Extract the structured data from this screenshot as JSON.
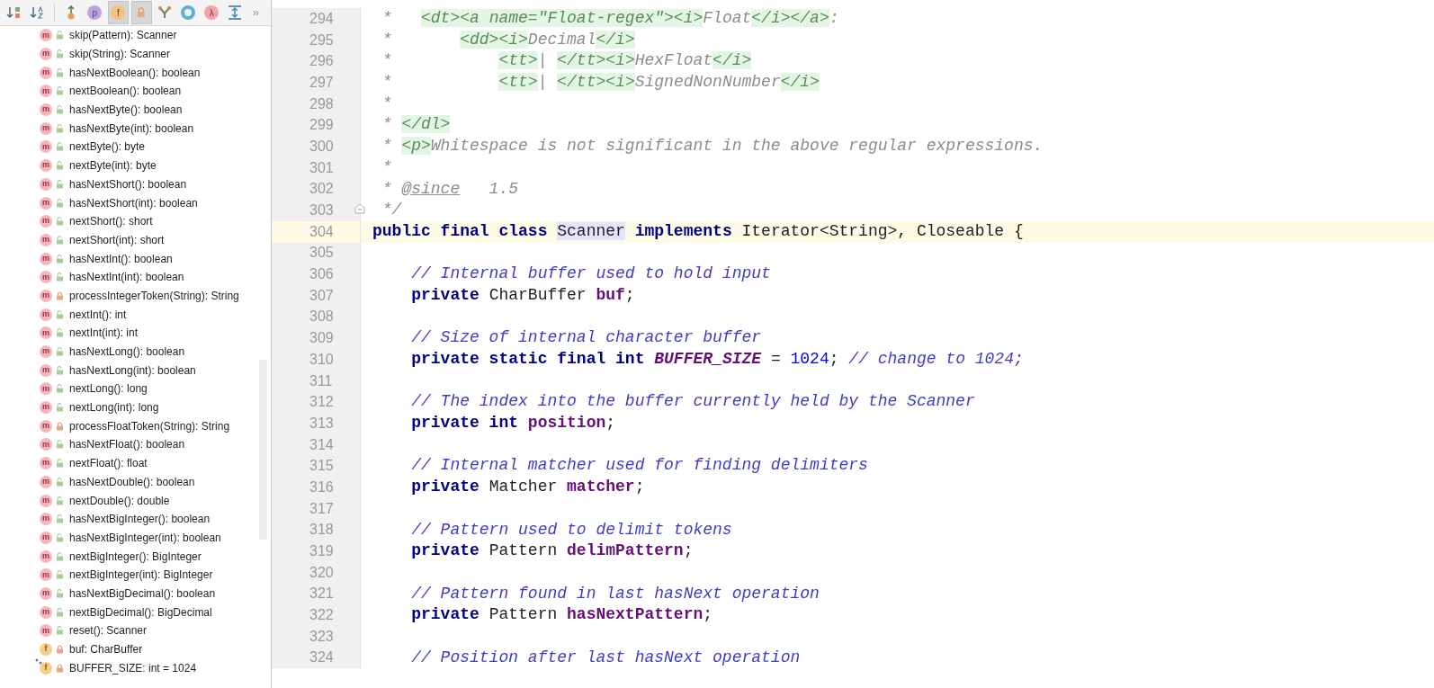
{
  "toolbar": [
    {
      "kind": "sort-visibility",
      "selected": false
    },
    {
      "kind": "sort-alpha",
      "selected": false
    },
    {
      "kind": "separator"
    },
    {
      "kind": "inherited",
      "selected": false
    },
    {
      "kind": "letter",
      "label": "p",
      "color": "#b9a6e0",
      "selected": false
    },
    {
      "kind": "letter",
      "label": "f",
      "color": "#f2c37a",
      "selected": true
    },
    {
      "kind": "lock",
      "selected": true
    },
    {
      "kind": "anonymous",
      "selected": false
    },
    {
      "kind": "ring",
      "selected": false
    },
    {
      "kind": "letter",
      "label": "λ",
      "color": "#f1a3a8",
      "selected": false
    },
    {
      "kind": "expand",
      "selected": false
    },
    {
      "kind": "more",
      "label": "»",
      "selected": false
    }
  ],
  "members": [
    {
      "kind": "method",
      "badge": "m",
      "private": false,
      "label": "skip(Pattern): Scanner"
    },
    {
      "kind": "method",
      "badge": "m",
      "private": false,
      "label": "skip(String): Scanner"
    },
    {
      "kind": "method",
      "badge": "m",
      "private": false,
      "label": "hasNextBoolean(): boolean"
    },
    {
      "kind": "method",
      "badge": "m",
      "private": false,
      "label": "nextBoolean(): boolean"
    },
    {
      "kind": "method",
      "badge": "m",
      "private": false,
      "label": "hasNextByte(): boolean"
    },
    {
      "kind": "method",
      "badge": "m",
      "private": false,
      "label": "hasNextByte(int): boolean"
    },
    {
      "kind": "method",
      "badge": "m",
      "private": false,
      "label": "nextByte(): byte"
    },
    {
      "kind": "method",
      "badge": "m",
      "private": false,
      "label": "nextByte(int): byte"
    },
    {
      "kind": "method",
      "badge": "m",
      "private": false,
      "label": "hasNextShort(): boolean"
    },
    {
      "kind": "method",
      "badge": "m",
      "private": false,
      "label": "hasNextShort(int): boolean"
    },
    {
      "kind": "method",
      "badge": "m",
      "private": false,
      "label": "nextShort(): short"
    },
    {
      "kind": "method",
      "badge": "m",
      "private": false,
      "label": "nextShort(int): short"
    },
    {
      "kind": "method",
      "badge": "m",
      "private": false,
      "label": "hasNextInt(): boolean"
    },
    {
      "kind": "method",
      "badge": "m",
      "private": false,
      "label": "hasNextInt(int): boolean"
    },
    {
      "kind": "method",
      "badge": "m",
      "private": true,
      "label": "processIntegerToken(String): String"
    },
    {
      "kind": "method",
      "badge": "m",
      "private": false,
      "label": "nextInt(): int"
    },
    {
      "kind": "method",
      "badge": "m",
      "private": false,
      "label": "nextInt(int): int"
    },
    {
      "kind": "method",
      "badge": "m",
      "private": false,
      "label": "hasNextLong(): boolean"
    },
    {
      "kind": "method",
      "badge": "m",
      "private": false,
      "label": "hasNextLong(int): boolean"
    },
    {
      "kind": "method",
      "badge": "m",
      "private": false,
      "label": "nextLong(): long"
    },
    {
      "kind": "method",
      "badge": "m",
      "private": false,
      "label": "nextLong(int): long"
    },
    {
      "kind": "method",
      "badge": "m",
      "private": true,
      "label": "processFloatToken(String): String"
    },
    {
      "kind": "method",
      "badge": "m",
      "private": false,
      "label": "hasNextFloat(): boolean"
    },
    {
      "kind": "method",
      "badge": "m",
      "private": false,
      "label": "nextFloat(): float"
    },
    {
      "kind": "method",
      "badge": "m",
      "private": false,
      "label": "hasNextDouble(): boolean"
    },
    {
      "kind": "method",
      "badge": "m",
      "private": false,
      "label": "nextDouble(): double"
    },
    {
      "kind": "method",
      "badge": "m",
      "private": false,
      "label": "hasNextBigInteger(): boolean"
    },
    {
      "kind": "method",
      "badge": "m",
      "private": false,
      "label": "hasNextBigInteger(int): boolean"
    },
    {
      "kind": "method",
      "badge": "m",
      "private": false,
      "label": "nextBigInteger(): BigInteger"
    },
    {
      "kind": "method",
      "badge": "m",
      "private": false,
      "label": "nextBigInteger(int): BigInteger"
    },
    {
      "kind": "method",
      "badge": "m",
      "private": false,
      "label": "hasNextBigDecimal(): boolean"
    },
    {
      "kind": "method",
      "badge": "m",
      "private": false,
      "label": "nextBigDecimal(): BigDecimal"
    },
    {
      "kind": "method",
      "badge": "m",
      "private": false,
      "label": "reset(): Scanner"
    },
    {
      "kind": "field",
      "badge": "f",
      "private": true,
      "label": "buf: CharBuffer"
    },
    {
      "kind": "static-field",
      "badge": "f",
      "private": true,
      "label": "BUFFER_SIZE: int = 1024"
    }
  ],
  "code": [
    {
      "number": "294",
      "current": false,
      "tokens": [
        {
          "kind": "doc",
          "text": " *   "
        },
        {
          "kind": "tag",
          "text": "<dt><a name=\"Float-regex\"><i>"
        },
        {
          "kind": "doc",
          "text": "Float"
        },
        {
          "kind": "tag",
          "text": "</i></a>"
        },
        {
          "kind": "doc",
          "text": ":"
        }
      ]
    },
    {
      "number": "295",
      "current": false,
      "tokens": [
        {
          "kind": "doc",
          "text": " *       "
        },
        {
          "kind": "tag",
          "text": "<dd><i>"
        },
        {
          "kind": "doc",
          "text": "Decimal"
        },
        {
          "kind": "tag",
          "text": "</i>"
        }
      ]
    },
    {
      "number": "296",
      "current": false,
      "tokens": [
        {
          "kind": "doc",
          "text": " *           "
        },
        {
          "kind": "tag",
          "text": "<tt>"
        },
        {
          "kind": "doc",
          "text": "| "
        },
        {
          "kind": "tag",
          "text": "</tt><i>"
        },
        {
          "kind": "doc",
          "text": "HexFloat"
        },
        {
          "kind": "tag",
          "text": "</i>"
        }
      ]
    },
    {
      "number": "297",
      "current": false,
      "tokens": [
        {
          "kind": "doc",
          "text": " *           "
        },
        {
          "kind": "tag",
          "text": "<tt>"
        },
        {
          "kind": "doc",
          "text": "| "
        },
        {
          "kind": "tag",
          "text": "</tt><i>"
        },
        {
          "kind": "doc",
          "text": "SignedNonNumber"
        },
        {
          "kind": "tag",
          "text": "</i>"
        }
      ]
    },
    {
      "number": "298",
      "current": false,
      "tokens": [
        {
          "kind": "doc",
          "text": " *"
        }
      ]
    },
    {
      "number": "299",
      "current": false,
      "tokens": [
        {
          "kind": "doc",
          "text": " * "
        },
        {
          "kind": "tag",
          "text": "</dl>"
        }
      ]
    },
    {
      "number": "300",
      "current": false,
      "tokens": [
        {
          "kind": "doc",
          "text": " * "
        },
        {
          "kind": "tag",
          "text": "<p>"
        },
        {
          "kind": "doc",
          "text": "Whitespace is not significant in the above regular expressions."
        }
      ]
    },
    {
      "number": "301",
      "current": false,
      "tokens": [
        {
          "kind": "doc",
          "text": " *"
        }
      ]
    },
    {
      "number": "302",
      "current": false,
      "tokens": [
        {
          "kind": "doc",
          "text": " * "
        },
        {
          "kind": "doctag",
          "text": "@since"
        },
        {
          "kind": "doc",
          "text": "   1.5"
        }
      ]
    },
    {
      "number": "303",
      "current": false,
      "fold": true,
      "tokens": [
        {
          "kind": "doc",
          "text": " */"
        }
      ]
    },
    {
      "number": "304",
      "current": true,
      "tokens": [
        {
          "kind": "keyword",
          "text": "public final class "
        },
        {
          "kind": "usage",
          "text": "Scanner"
        },
        {
          "kind": "keyword",
          "text": " implements "
        },
        {
          "kind": "plain",
          "text": "Iterator<String>, Closeable {"
        }
      ]
    },
    {
      "number": "305",
      "current": false
    },
    {
      "number": "306",
      "current": false,
      "tokens": [
        {
          "kind": "comment",
          "text": "    // Internal buffer used to hold input"
        }
      ]
    },
    {
      "number": "307",
      "current": false,
      "tokens": [
        {
          "kind": "keyword",
          "text": "    private "
        },
        {
          "kind": "plain",
          "text": "CharBuffer "
        },
        {
          "kind": "field",
          "text": "buf"
        },
        {
          "kind": "plain",
          "text": ";"
        }
      ]
    },
    {
      "number": "308",
      "current": false
    },
    {
      "number": "309",
      "current": false,
      "tokens": [
        {
          "kind": "comment",
          "text": "    // Size of internal character buffer"
        }
      ]
    },
    {
      "number": "310",
      "current": false,
      "tokens": [
        {
          "kind": "keyword",
          "text": "    private static final int "
        },
        {
          "kind": "constant",
          "text": "BUFFER_SIZE"
        },
        {
          "kind": "plain",
          "text": " = "
        },
        {
          "kind": "number",
          "text": "1024"
        },
        {
          "kind": "plain",
          "text": "; "
        },
        {
          "kind": "comment",
          "text": "// change to 1024;"
        }
      ]
    },
    {
      "number": "311",
      "current": false
    },
    {
      "number": "312",
      "current": false,
      "tokens": [
        {
          "kind": "comment",
          "text": "    // The index into the buffer currently held by the Scanner"
        }
      ]
    },
    {
      "number": "313",
      "current": false,
      "tokens": [
        {
          "kind": "keyword",
          "text": "    private int "
        },
        {
          "kind": "field",
          "text": "position"
        },
        {
          "kind": "plain",
          "text": ";"
        }
      ]
    },
    {
      "number": "314",
      "current": false
    },
    {
      "number": "315",
      "current": false,
      "tokens": [
        {
          "kind": "comment",
          "text": "    // Internal matcher used for finding delimiters"
        }
      ]
    },
    {
      "number": "316",
      "current": false,
      "tokens": [
        {
          "kind": "keyword",
          "text": "    private "
        },
        {
          "kind": "plain",
          "text": "Matcher "
        },
        {
          "kind": "field",
          "text": "matcher"
        },
        {
          "kind": "plain",
          "text": ";"
        }
      ]
    },
    {
      "number": "317",
      "current": false
    },
    {
      "number": "318",
      "current": false,
      "tokens": [
        {
          "kind": "comment",
          "text": "    // Pattern used to delimit tokens"
        }
      ]
    },
    {
      "number": "319",
      "current": false,
      "tokens": [
        {
          "kind": "keyword",
          "text": "    private "
        },
        {
          "kind": "plain",
          "text": "Pattern "
        },
        {
          "kind": "field",
          "text": "delimPattern"
        },
        {
          "kind": "plain",
          "text": ";"
        }
      ]
    },
    {
      "number": "320",
      "current": false
    },
    {
      "number": "321",
      "current": false,
      "tokens": [
        {
          "kind": "comment",
          "text": "    // Pattern found in last hasNext operation"
        }
      ]
    },
    {
      "number": "322",
      "current": false,
      "tokens": [
        {
          "kind": "keyword",
          "text": "    private "
        },
        {
          "kind": "plain",
          "text": "Pattern "
        },
        {
          "kind": "field",
          "text": "hasNextPattern"
        },
        {
          "kind": "plain",
          "text": ";"
        }
      ]
    },
    {
      "number": "323",
      "current": false
    },
    {
      "number": "324",
      "current": false,
      "tokens": [
        {
          "kind": "comment",
          "text": "    // Position after last hasNext operation"
        }
      ]
    }
  ]
}
